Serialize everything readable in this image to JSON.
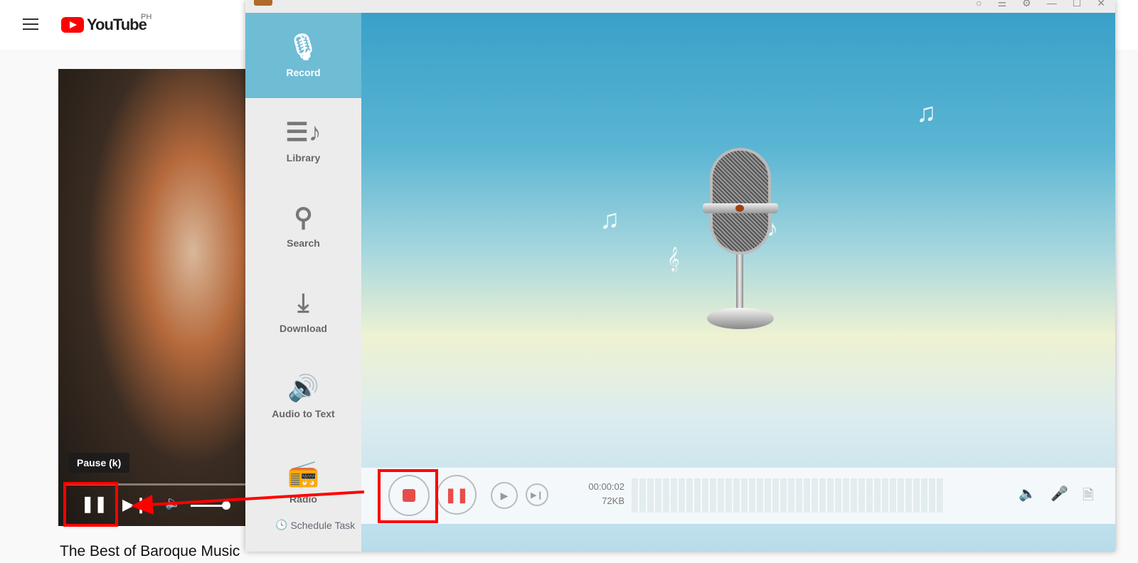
{
  "youtube": {
    "logo": "YouTube",
    "country": "PH",
    "tooltip": "Pause (k)",
    "video_title": "The Best of Baroque Music"
  },
  "recorder": {
    "sidebar": [
      {
        "label": "Record",
        "icon": "microphone-icon",
        "active": true
      },
      {
        "label": "Library",
        "icon": "library-icon"
      },
      {
        "label": "Search",
        "icon": "search-icon"
      },
      {
        "label": "Download",
        "icon": "download-icon"
      },
      {
        "label": "Audio to Text",
        "icon": "audio-to-text-icon"
      },
      {
        "label": "Radio",
        "icon": "radio-icon"
      }
    ],
    "time": "00:00:02",
    "size": "72KB",
    "schedule": "Schedule Task",
    "colors": {
      "accent": "#6fbcd5",
      "stop": "#e84c4c",
      "annotation": "#ff0000"
    }
  }
}
